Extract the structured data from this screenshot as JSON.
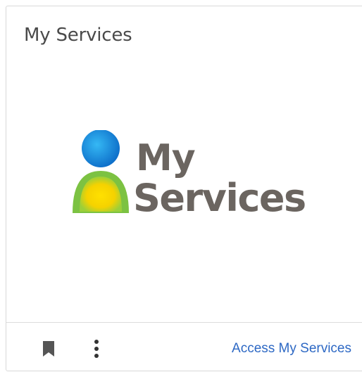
{
  "card": {
    "title": "My Services",
    "logo": {
      "icon": "person-icon",
      "line1": "My",
      "line2": "Services",
      "text_color": "#6b6560",
      "head_color": "#1a8fe0",
      "body_outer_color": "#7cc242",
      "body_inner_color": "#ffd200"
    },
    "footer": {
      "bookmark_icon": "bookmark-icon",
      "more_icon": "more-vertical-icon",
      "link_label": "Access My Services",
      "link_color": "#2d68c4"
    }
  }
}
